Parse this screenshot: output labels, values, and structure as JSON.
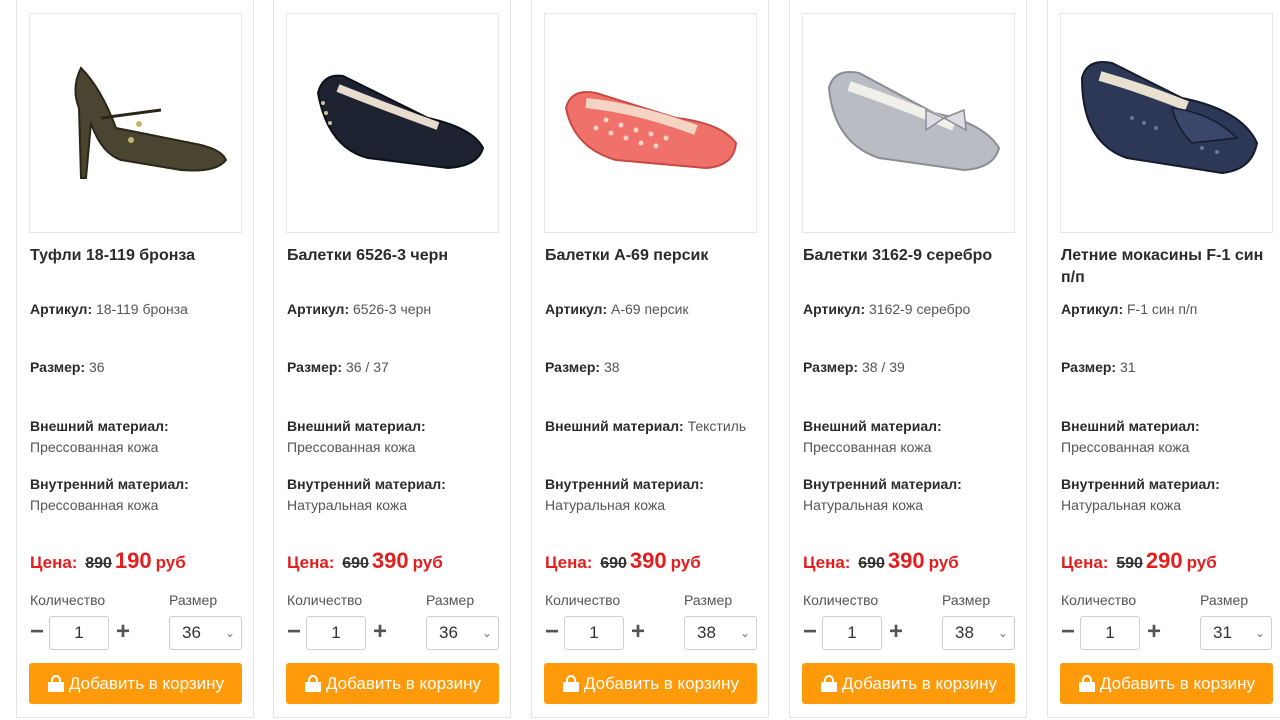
{
  "labels": {
    "sku": "Артикул:",
    "size": "Размер:",
    "outer": "Внешний материал:",
    "inner": "Внутренний материал:",
    "price": "Цена:",
    "currency": "руб",
    "quantity": "Количество",
    "size_select": "Размер",
    "add_to_cart": "Добавить в корзину",
    "minus": "−",
    "plus": "+",
    "chevron": "⌄"
  },
  "products": [
    {
      "title": "Туфли 18-119 бронза",
      "sku": "18-119 бронза",
      "size": "36",
      "outer": "Прессованная кожа",
      "inner": "Прессованная кожа",
      "old_price": "890",
      "new_price": "190",
      "qty": "1",
      "selected_size": "36",
      "image_icon": "bronze-pump-icon",
      "color": "#4a4530"
    },
    {
      "title": "Балетки 6526-3 черн",
      "sku": "6526-3 черн",
      "size": "36 / 37",
      "outer": "Прессованная кожа",
      "inner": "Натуральная кожа",
      "old_price": "690",
      "new_price": "390",
      "qty": "1",
      "selected_size": "36",
      "image_icon": "black-ballet-flat-icon",
      "color": "#1d2230"
    },
    {
      "title": "Балетки А-69 персик",
      "sku": "А-69 персик",
      "size": "38",
      "outer": "Текстиль",
      "inner": "Натуральная кожа",
      "old_price": "690",
      "new_price": "390",
      "qty": "1",
      "selected_size": "38",
      "image_icon": "peach-ballet-flat-icon",
      "color": "#f0706a"
    },
    {
      "title": "Балетки 3162-9 серебро",
      "sku": "3162-9 серебро",
      "size": "38 / 39",
      "outer": "Прессованная кожа",
      "inner": "Натуральная кожа",
      "old_price": "690",
      "new_price": "390",
      "qty": "1",
      "selected_size": "38",
      "image_icon": "silver-ballet-flat-icon",
      "color": "#b9bcc3"
    },
    {
      "title": "Летние мокасины F-1 син п/п",
      "sku": "F-1 син п/п",
      "size": "31",
      "outer": "Прессованная кожа",
      "inner": "Натуральная кожа",
      "old_price": "590",
      "new_price": "290",
      "qty": "1",
      "selected_size": "31",
      "image_icon": "blue-moccasin-icon",
      "color": "#2c3856"
    }
  ],
  "colors": {
    "accent": "#ff9a0b",
    "price_red": "#e41e1e"
  }
}
